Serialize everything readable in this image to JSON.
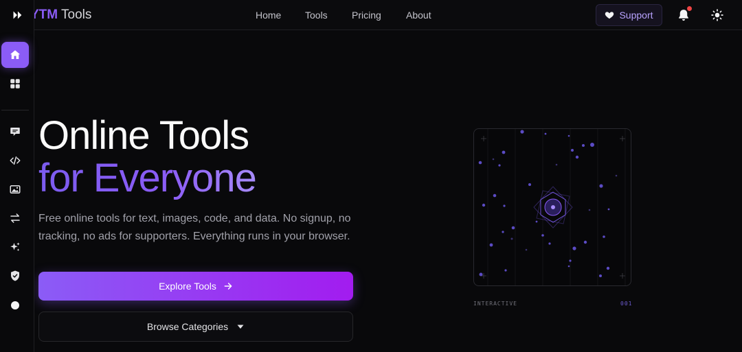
{
  "brand": {
    "accent": "YTM",
    "name": "Tools"
  },
  "nav": {
    "links": [
      "Home",
      "Tools",
      "Pricing",
      "About"
    ],
    "support_label": "Support"
  },
  "sidebar": {
    "items": [
      {
        "icon": "home-icon",
        "active": true
      },
      {
        "icon": "grid-icon"
      },
      {
        "icon": "chat-icon"
      },
      {
        "icon": "code-icon"
      },
      {
        "icon": "image-icon"
      },
      {
        "icon": "arrows-swap-icon"
      },
      {
        "icon": "sparkles-icon"
      },
      {
        "icon": "shield-check-icon"
      },
      {
        "icon": "circle-icon"
      }
    ]
  },
  "hero": {
    "title_line1": "Online Tools",
    "title_line2": "for Everyone",
    "subtitle": "Free online tools for text, images, code, and data. No signup, no tracking, no ads for supporters. Everything runs in your browser.",
    "primary_cta": "Explore Tools",
    "secondary_cta": "Browse Categories"
  },
  "visual": {
    "label_left": "INTERACTIVE",
    "label_right": "001"
  },
  "colors": {
    "accent": "#8b5cf6",
    "background": "#09090b",
    "notification": "#ef4444"
  }
}
